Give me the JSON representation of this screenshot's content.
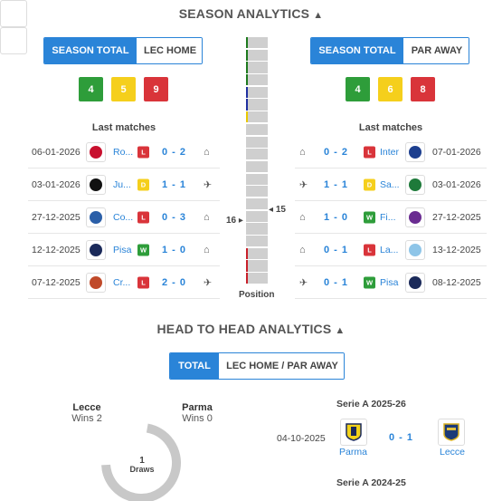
{
  "season": {
    "title": "SEASON ANALYTICS",
    "collapse_icon": "chevron-up-icon",
    "left": {
      "toggle": [
        "SEASON TOTAL",
        "LEC HOME"
      ],
      "tally": {
        "wins": "4",
        "draws": "5",
        "losses": "9"
      },
      "last_title": "Last matches",
      "matches": [
        {
          "date": "06-01-2026",
          "team": "Ro...",
          "result": "L",
          "score": "0 - 2",
          "venue_icon": "home-icon",
          "crest_color": "#c8102e"
        },
        {
          "date": "03-01-2026",
          "team": "Ju...",
          "result": "D",
          "score": "1 - 1",
          "venue_icon": "plane-icon",
          "crest_color": "#111111"
        },
        {
          "date": "27-12-2025",
          "team": "Co...",
          "result": "L",
          "score": "0 - 3",
          "venue_icon": "home-icon",
          "crest_color": "#2b5fa8"
        },
        {
          "date": "12-12-2025",
          "team": "Pisa",
          "result": "W",
          "score": "1 - 0",
          "venue_icon": "home-icon",
          "crest_color": "#1b2a5a"
        },
        {
          "date": "07-12-2025",
          "team": "Cr...",
          "result": "L",
          "score": "2 - 0",
          "venue_icon": "plane-icon",
          "crest_color": "#c04a2a"
        }
      ]
    },
    "right": {
      "toggle": [
        "SEASON TOTAL",
        "PAR AWAY"
      ],
      "tally": {
        "wins": "4",
        "draws": "6",
        "losses": "8"
      },
      "last_title": "Last matches",
      "matches": [
        {
          "date": "07-01-2026",
          "team": "Inter",
          "result": "L",
          "score": "0 - 2",
          "venue_icon": "home-icon",
          "crest_color": "#1d3f8f"
        },
        {
          "date": "03-01-2026",
          "team": "Sa...",
          "result": "D",
          "score": "1 - 1",
          "venue_icon": "plane-icon",
          "crest_color": "#1e7a3a"
        },
        {
          "date": "27-12-2025",
          "team": "Fi...",
          "result": "W",
          "score": "1 - 0",
          "venue_icon": "home-icon",
          "crest_color": "#6a2c91"
        },
        {
          "date": "13-12-2025",
          "team": "La...",
          "result": "L",
          "score": "0 - 1",
          "venue_icon": "home-icon",
          "crest_color": "#8ec5e8"
        },
        {
          "date": "08-12-2025",
          "team": "Pisa",
          "result": "W",
          "score": "0 - 1",
          "venue_icon": "plane-icon",
          "crest_color": "#1b2a5a"
        }
      ]
    },
    "position": {
      "label": "Position",
      "left_value": "16",
      "right_value": "15",
      "marks": [
        "#1e7a1e",
        "#1e7a1e",
        "#1e7a1e",
        "#1e7a1e",
        "#2030a0",
        "#2030a0",
        "#e8c800",
        "",
        "",
        "",
        "",
        "",
        "",
        "",
        "",
        "",
        "",
        "#c8202a",
        "#c8202a",
        "#c8202a"
      ]
    }
  },
  "h2h": {
    "title": "HEAD TO HEAD ANALYTICS",
    "collapse_icon": "chevron-up-icon",
    "toggle": [
      "TOTAL",
      "LEC HOME / PAR AWAY"
    ],
    "home": {
      "name": "Lecce",
      "wins": "Wins 2"
    },
    "away": {
      "name": "Parma",
      "wins": "Wins 0"
    },
    "draws": {
      "count": "1",
      "label": "Draws"
    },
    "seasons": [
      {
        "title": "Serie A 2025-26",
        "date": "04-10-2025",
        "home_team": "Parma",
        "score": "0 - 1",
        "away_team": "Lecce"
      },
      {
        "title": "Serie A 2024-25"
      }
    ],
    "colors": {
      "home": "#c8c8c8",
      "draw": "#c8c8c8",
      "accent": "#2a84d8"
    }
  }
}
